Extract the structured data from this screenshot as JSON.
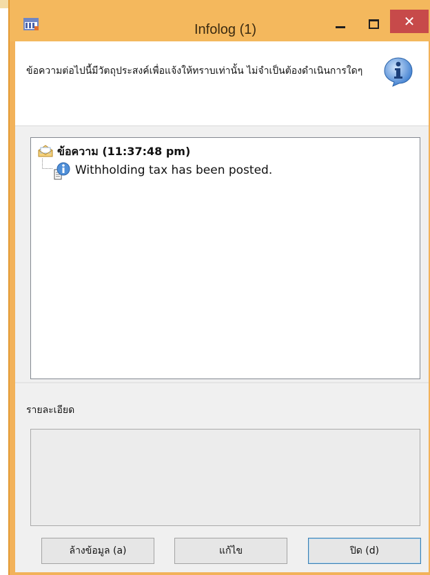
{
  "window": {
    "title": "Infolog (1)",
    "close_glyph": "✕"
  },
  "header": {
    "message": "ข้อความต่อไปนี้มีวัตถุประสงค์เพื่อแจ้งให้ทราบเท่านั้น ไม่จำเป็นต้องดำเนินการใดๆ",
    "icon": "info-icon"
  },
  "messages": {
    "group_label": "ข้อความ (11:37:48 pm)",
    "group_icon": "mail-icon",
    "items": [
      {
        "text": "Withholding tax has been posted.",
        "icon": "info-document-icon"
      }
    ]
  },
  "details": {
    "label": "รายละเอียด",
    "value": ""
  },
  "buttons": {
    "clear": "ล้างข้อมูล (a)",
    "fix": "แก้ไข",
    "close": "ปิด (d)"
  },
  "colors": {
    "title_bar": "#f4b85d",
    "close_button": "#c74a4a",
    "panel": "#f0f0f0"
  }
}
